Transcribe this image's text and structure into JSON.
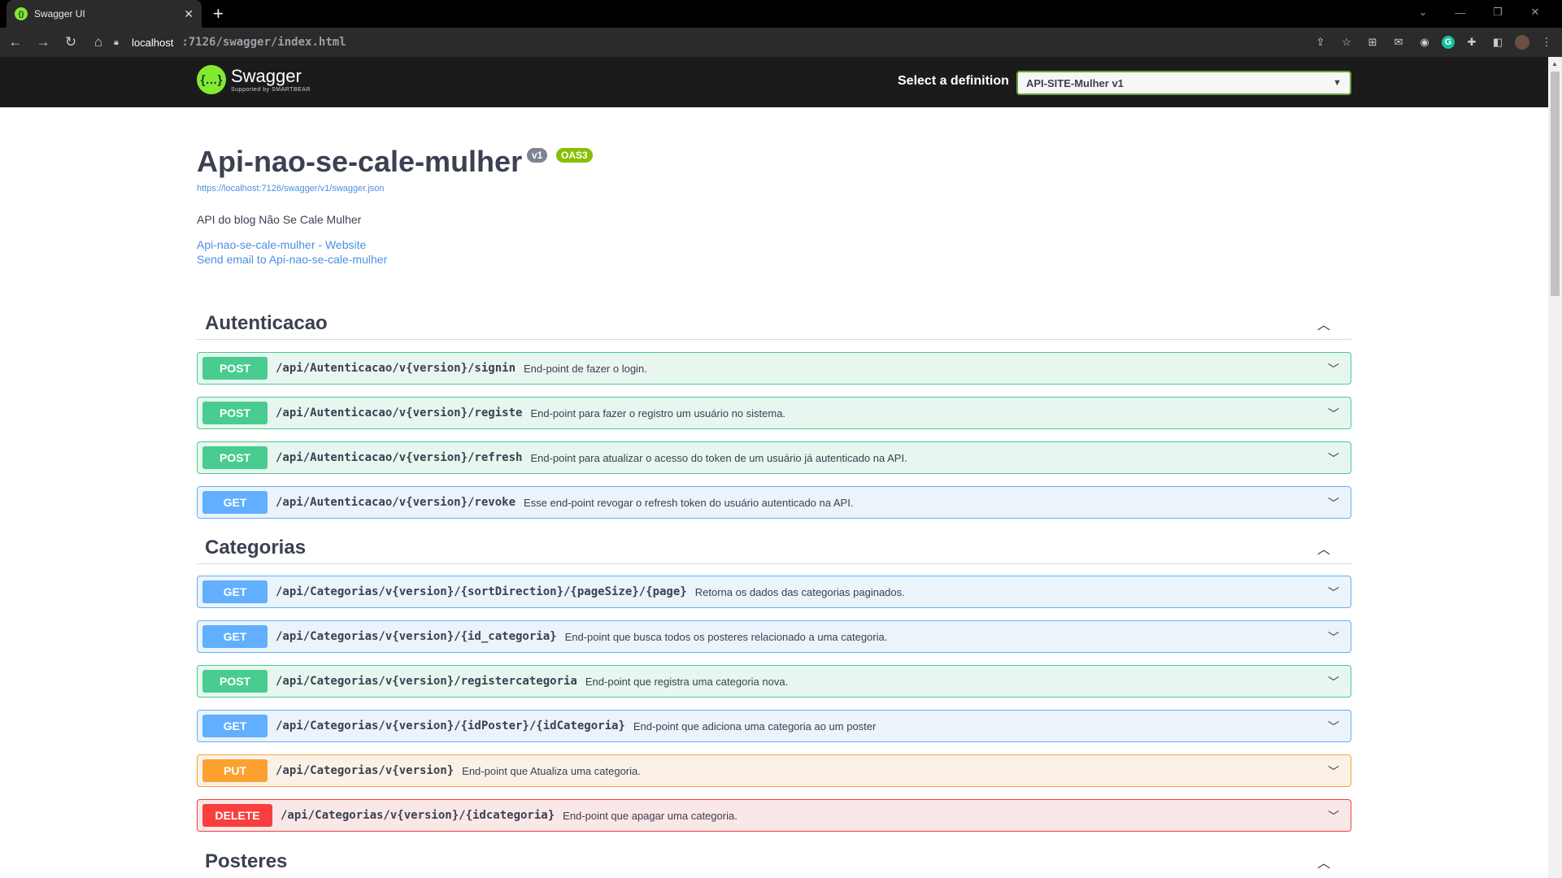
{
  "browser": {
    "tab_title": "Swagger UI",
    "url_host": "localhost",
    "url_path": ":7126/swagger/index.html"
  },
  "topbar": {
    "logo_name": "Swagger",
    "logo_sub": "Supported by SMARTBEAR",
    "definition_label": "Select a definition",
    "definition_value": "API-SITE-Mulher v1"
  },
  "info": {
    "title": "Api-nao-se-cale-mulher",
    "version_badge": "v1",
    "oas_badge": "OAS3",
    "spec_url": "https://localhost:7126/swagger/v1/swagger.json",
    "description": "API do blog Não Se Cale Mulher",
    "website_link": "Api-nao-se-cale-mulher - Website",
    "email_link": "Send email to Api-nao-se-cale-mulher"
  },
  "tags": [
    {
      "name": "Autenticacao"
    },
    {
      "name": "Categorias"
    },
    {
      "name": "Posteres"
    }
  ],
  "operations": [
    {
      "method": "POST",
      "path": "/api/Autenticacao/v{version}/signin",
      "summary": "End-point de fazer o login."
    },
    {
      "method": "POST",
      "path": "/api/Autenticacao/v{version}/registe",
      "summary": "End-point para fazer o registro um usuário no sistema."
    },
    {
      "method": "POST",
      "path": "/api/Autenticacao/v{version}/refresh",
      "summary": "End-point para atualizar o acesso do token de um usuário já autenticado na API."
    },
    {
      "method": "GET",
      "path": "/api/Autenticacao/v{version}/revoke",
      "summary": "Esse end-point revogar o refresh token do usuário autenticado na API."
    },
    {
      "method": "GET",
      "path": "/api/Categorias/v{version}/{sortDirection}/{pageSize}/{page}",
      "summary": "Retorna os dados das categorias paginados."
    },
    {
      "method": "GET",
      "path": "/api/Categorias/v{version}/{id_categoria}",
      "summary": "End-point que busca todos os posteres relacionado a uma categoria."
    },
    {
      "method": "POST",
      "path": "/api/Categorias/v{version}/registercategoria",
      "summary": "End-point que registra uma categoria nova."
    },
    {
      "method": "GET",
      "path": "/api/Categorias/v{version}/{idPoster}/{idCategoria}",
      "summary": "End-point que adiciona uma categoria ao um poster"
    },
    {
      "method": "PUT",
      "path": "/api/Categorias/v{version}",
      "summary": "End-point que Atualiza uma categoria."
    },
    {
      "method": "DELETE",
      "path": "/api/Categorias/v{version}/{idcategoria}",
      "summary": "End-point que apagar uma categoria."
    }
  ]
}
